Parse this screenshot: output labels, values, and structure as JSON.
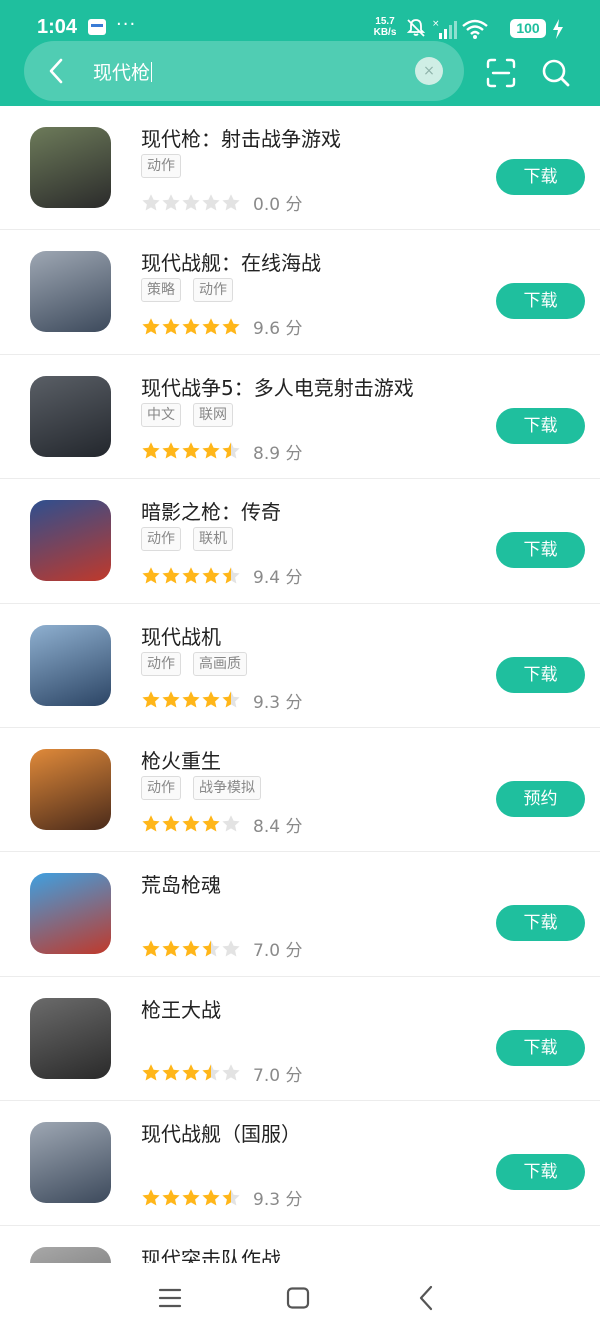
{
  "status_bar": {
    "time": "1:04",
    "more": "···",
    "net_speed_value": "15.7",
    "net_speed_unit": "KB/s",
    "battery": "100"
  },
  "search": {
    "query": "现代枪",
    "clear_symbol": "×"
  },
  "results": [
    {
      "title": "现代枪：射击战争游戏",
      "tags": [
        "动作"
      ],
      "rating": 0.0,
      "score": "0.0 分",
      "button": "下载",
      "icon": "scope-sniper-icon",
      "colors": [
        "#6d7b5a",
        "#2b2b2b"
      ]
    },
    {
      "title": "现代战舰：在线海战",
      "tags": [
        "策略",
        "动作"
      ],
      "rating": 5.0,
      "score": "9.6 分",
      "button": "下载",
      "icon": "warship-5v5-icon",
      "colors": [
        "#9ea7b3",
        "#3d4a5c"
      ]
    },
    {
      "title": "现代战争5：多人电竞射击游戏",
      "tags": [
        "中文",
        "联网"
      ],
      "rating": 4.5,
      "score": "8.9 分",
      "button": "下载",
      "icon": "soldier-rifle-icon",
      "colors": [
        "#5a5f66",
        "#23272d"
      ]
    },
    {
      "title": "暗影之枪：传奇",
      "tags": [
        "动作",
        "联机"
      ],
      "rating": 4.5,
      "score": "9.4 分",
      "button": "下载",
      "icon": "shadowgun-legends-icon",
      "colors": [
        "#2e4f8f",
        "#c0392b"
      ]
    },
    {
      "title": "现代战机",
      "tags": [
        "动作",
        "高画质"
      ],
      "rating": 4.5,
      "score": "9.3 分",
      "button": "下载",
      "icon": "fighter-jet-2024-icon",
      "colors": [
        "#8fb0d0",
        "#2c4565"
      ]
    },
    {
      "title": "枪火重生",
      "tags": [
        "动作",
        "战争模拟"
      ],
      "rating": 4.0,
      "score": "8.4 分",
      "button": "预约",
      "icon": "cat-gunslinger-icon",
      "colors": [
        "#e08a3a",
        "#4a2a1a"
      ]
    },
    {
      "title": "荒岛枪魂",
      "tags": [],
      "rating": 3.5,
      "score": "7.0 分",
      "button": "下载",
      "icon": "cartoon-gunner-icon",
      "colors": [
        "#3fa0e0",
        "#c0392b"
      ]
    },
    {
      "title": "枪王大战",
      "tags": [],
      "rating": 3.5,
      "score": "7.0 分",
      "button": "下载",
      "icon": "crosshair-target-icon",
      "colors": [
        "#6b6b6b",
        "#2a2a2a"
      ]
    },
    {
      "title": "现代战舰（国服）",
      "tags": [],
      "rating": 4.5,
      "score": "9.3 分",
      "button": "下载",
      "icon": "warship-5v5-icon",
      "colors": [
        "#9ea7b3",
        "#3d4a5c"
      ]
    },
    {
      "title": "现代突击队作战",
      "tags": [],
      "rating": null,
      "score": "",
      "button": "",
      "icon": "commando-icon",
      "colors": [
        "#a8a8a8",
        "#666666"
      ]
    }
  ],
  "colors": {
    "accent": "#1fbf9e",
    "star": "#ffb619",
    "star_empty": "#e3e3e3"
  }
}
